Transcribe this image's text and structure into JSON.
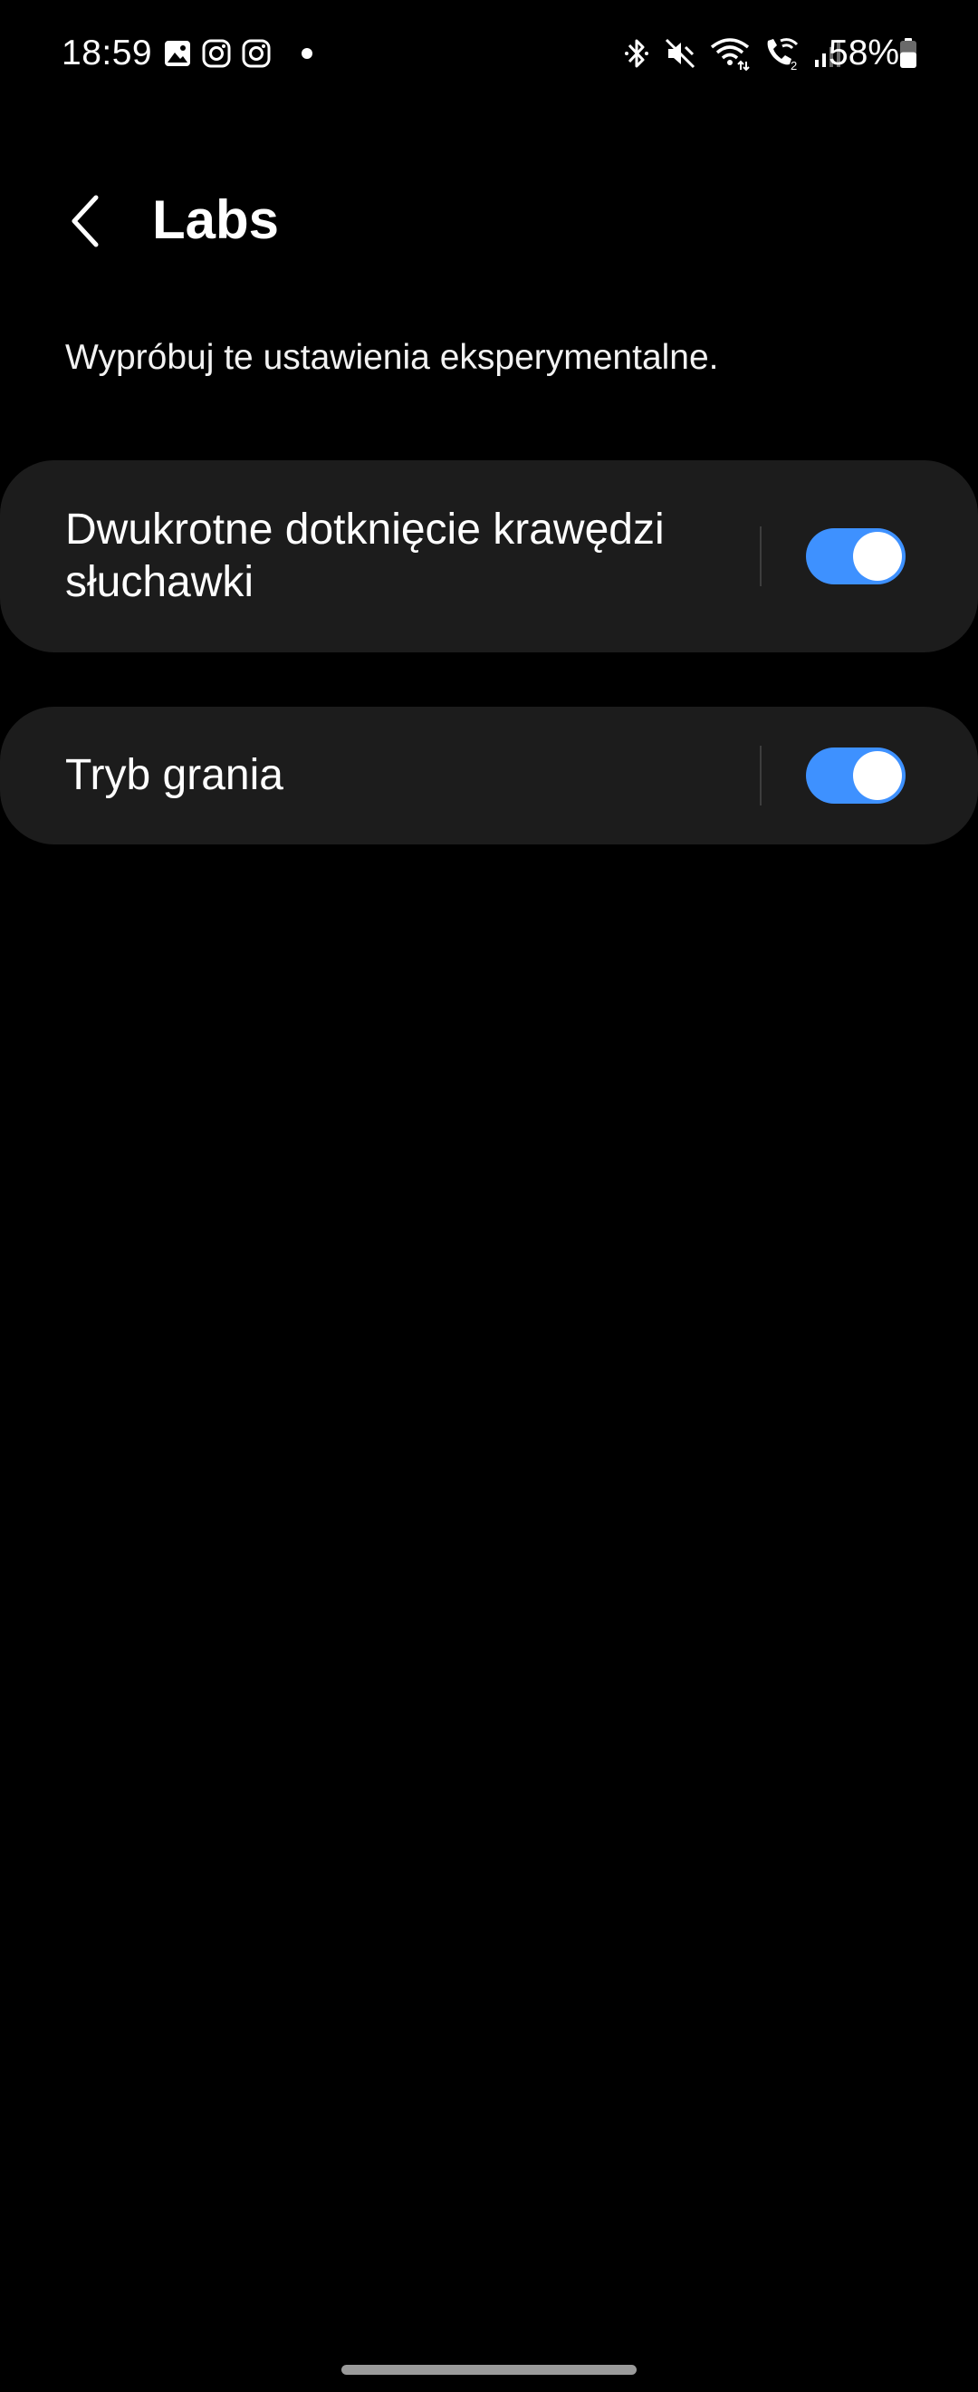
{
  "status_bar": {
    "time": "18:59",
    "left_icons": [
      "gallery-icon",
      "instagram-icon",
      "instagram-icon",
      "notification-dot"
    ],
    "right_icons": [
      "bluetooth-icon",
      "mute-icon",
      "wifi-icon",
      "wifi-calling-icon",
      "signal-icon"
    ],
    "battery_percent": "58%",
    "battery_level": 0.58
  },
  "header": {
    "back_icon": "chevron-left-icon",
    "title": "Labs"
  },
  "description": "Wypróbuj te ustawienia eksperymentalne.",
  "settings": [
    {
      "label": "Dwukrotne dotknięcie krawędzi słuchawki",
      "enabled": true
    },
    {
      "label": "Tryb grania",
      "enabled": true
    }
  ],
  "colors": {
    "background": "#000000",
    "card": "#1c1c1c",
    "toggle_on": "#3e91ff",
    "text": "#ffffff"
  }
}
